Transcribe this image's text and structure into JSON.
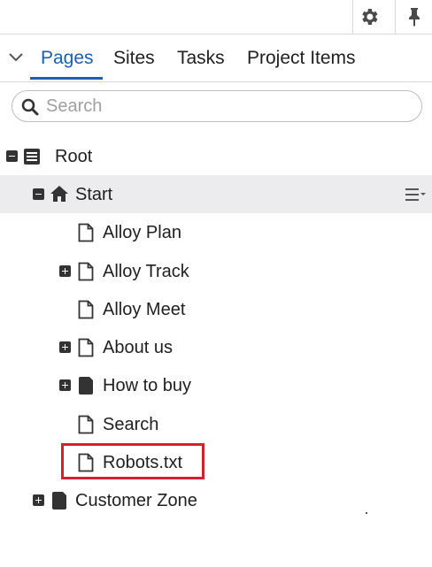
{
  "toolbar": {
    "settings_icon": "gear-icon",
    "pin_icon": "pin-icon"
  },
  "tabs": [
    {
      "label": "Pages",
      "active": true
    },
    {
      "label": "Sites",
      "active": false
    },
    {
      "label": "Tasks",
      "active": false
    },
    {
      "label": "Project Items",
      "active": false
    }
  ],
  "search": {
    "placeholder": "Search",
    "value": ""
  },
  "tree": {
    "root": {
      "label": "Root",
      "icon": "list-page-icon",
      "expanded": true
    },
    "start": {
      "label": "Start",
      "icon": "home-icon",
      "expanded": true,
      "selected": true
    },
    "children": [
      {
        "label": "Alloy Plan",
        "icon": "page-icon",
        "has_children": false
      },
      {
        "label": "Alloy Track",
        "icon": "page-icon",
        "has_children": true
      },
      {
        "label": "Alloy Meet",
        "icon": "page-icon",
        "has_children": false
      },
      {
        "label": "About us",
        "icon": "page-icon",
        "has_children": true
      },
      {
        "label": "How to buy",
        "icon": "container-page-icon",
        "has_children": true
      },
      {
        "label": "Search",
        "icon": "page-icon",
        "has_children": false
      },
      {
        "label": "Robots.txt",
        "icon": "page-icon",
        "has_children": false,
        "highlighted": true
      }
    ],
    "customer_zone": {
      "label": "Customer Zone",
      "icon": "container-page-icon",
      "has_children": true
    }
  },
  "colors": {
    "accent": "#1a5fb4",
    "highlight": "#d3212d",
    "selected_row": "#ececef"
  }
}
